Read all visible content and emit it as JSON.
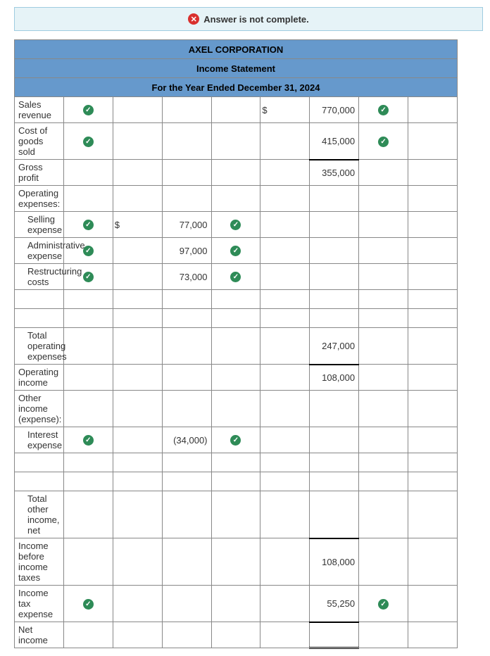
{
  "alert": {
    "text": "Answer is not complete."
  },
  "header": {
    "company": "AXEL CORPORATION",
    "title": "Income Statement",
    "period": "For the Year Ended December 31, 2024"
  },
  "rows": {
    "sales_revenue": {
      "label": "Sales revenue",
      "cur2": "$",
      "val2": "770,000"
    },
    "cogs": {
      "label": "Cost of goods sold",
      "val2": "415,000"
    },
    "gross_profit": {
      "label": "Gross profit",
      "val2": "355,000"
    },
    "opex_header": {
      "label": "Operating expenses:"
    },
    "selling": {
      "label": "Selling expense",
      "cur1": "$",
      "val1": "77,000"
    },
    "admin": {
      "label": "Administrative expense",
      "val1": "97,000"
    },
    "restructuring": {
      "label": "Restructuring costs",
      "val1": "73,000"
    },
    "total_opex": {
      "label": "Total operating expenses",
      "val2": "247,000"
    },
    "operating_income": {
      "label": "Operating income",
      "val2": "108,000"
    },
    "other_header": {
      "label": "Other income (expense):"
    },
    "interest": {
      "label": "Interest expense",
      "val1": "(34,000)"
    },
    "total_other": {
      "label": "Total other income, net"
    },
    "pretax": {
      "label": "Income before income taxes",
      "val2": "108,000"
    },
    "tax": {
      "label": "Income tax expense",
      "val2": "55,250"
    },
    "net_income": {
      "label": "Net income"
    }
  }
}
